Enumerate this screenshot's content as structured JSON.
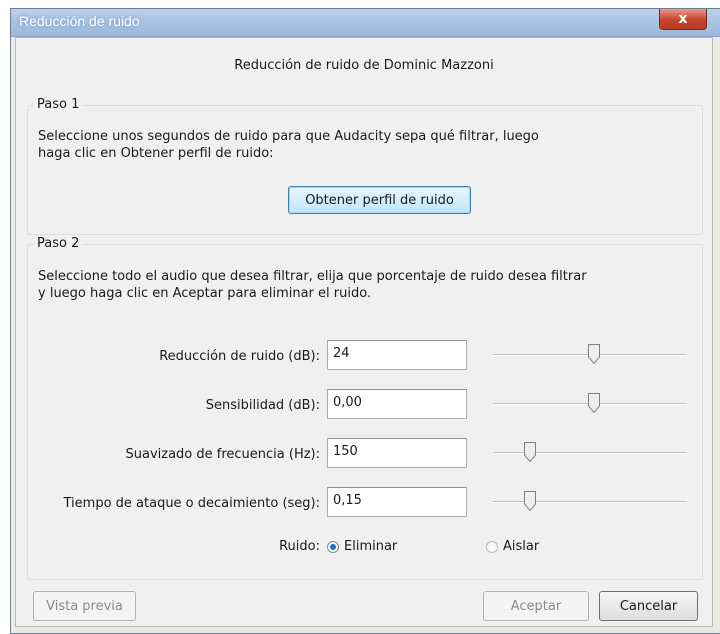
{
  "window": {
    "title": "Reducción de ruido",
    "close_glyph": "x"
  },
  "header": {
    "title": "Reducción de ruido de Dominic Mazzoni"
  },
  "step1": {
    "label": "Paso 1",
    "line1": "Seleccione unos segundos de ruido para que Audacity sepa qué filtrar, luego",
    "line2": "haga clic en Obtener perfil de ruido:",
    "button": "Obtener perfil de ruido"
  },
  "step2": {
    "label": "Paso 2",
    "line1": "Seleccione todo el audio que desea filtrar, elija que porcentaje de ruido desea filtrar",
    "line2": "y luego haga clic en Aceptar para eliminar el ruido.",
    "fields": [
      {
        "label": "Reducción de ruido (dB):",
        "value": "24",
        "slider_level": 0.52
      },
      {
        "label": "Sensibilidad (dB):",
        "value": "0,00",
        "slider_level": 0.52
      },
      {
        "label": "Suavizado de frecuencia (Hz):",
        "value": "150",
        "slider_level": 0.17
      },
      {
        "label": "Tiempo de ataque o decaimiento (seg):",
        "value": "0,15",
        "slider_level": 0.17
      }
    ],
    "noise": {
      "label": "Ruido:",
      "options": [
        {
          "label": "Eliminar",
          "selected": true
        },
        {
          "label": "Aislar",
          "selected": false
        }
      ]
    }
  },
  "buttons": {
    "preview": "Vista previa",
    "ok": "Aceptar",
    "cancel": "Cancelar"
  },
  "colors": {
    "title_bar": "#a6c1e1",
    "close_button": "#c7452c",
    "accent": "#1d6fc4"
  }
}
